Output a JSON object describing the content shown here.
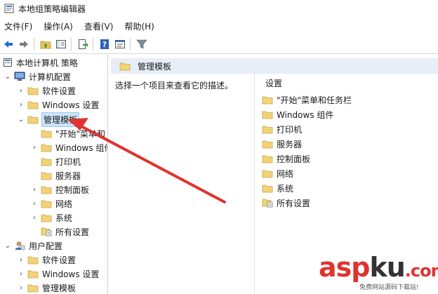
{
  "window": {
    "title": "本地组策略编辑器"
  },
  "menu": [
    {
      "label": "文件(F)"
    },
    {
      "label": "操作(A)"
    },
    {
      "label": "查看(V)"
    },
    {
      "label": "帮助(H)"
    }
  ],
  "toolbar": {
    "icons": [
      "back-arrow-icon",
      "forward-arrow-icon",
      "up-folder-icon",
      "show-hide-tree-icon",
      "export-list-icon",
      "help-icon",
      "properties-icon",
      "filter-icon"
    ]
  },
  "tree": [
    {
      "label": "本地计算机 策略",
      "depth": 0,
      "chev": "",
      "icon": "computer-policy-icon"
    },
    {
      "label": "计算机配置",
      "depth": 1,
      "chev": "v",
      "icon": "computer-icon"
    },
    {
      "label": "软件设置",
      "depth": 2,
      "chev": ">",
      "icon": "folder-icon"
    },
    {
      "label": "Windows 设置",
      "depth": 2,
      "chev": ">",
      "icon": "folder-icon"
    },
    {
      "label": "管理模板",
      "depth": 2,
      "chev": "v",
      "icon": "folder-icon",
      "selected": true
    },
    {
      "label": "\"开始\"菜单和",
      "depth": 3,
      "chev": "",
      "icon": "folder-icon"
    },
    {
      "label": "Windows 组件",
      "depth": 3,
      "chev": ">",
      "icon": "folder-icon"
    },
    {
      "label": "打印机",
      "depth": 3,
      "chev": "",
      "icon": "folder-icon"
    },
    {
      "label": "服务器",
      "depth": 3,
      "chev": "",
      "icon": "folder-icon"
    },
    {
      "label": "控制面板",
      "depth": 3,
      "chev": ">",
      "icon": "folder-icon"
    },
    {
      "label": "网络",
      "depth": 3,
      "chev": ">",
      "icon": "folder-icon"
    },
    {
      "label": "系统",
      "depth": 3,
      "chev": ">",
      "icon": "folder-icon"
    },
    {
      "label": "所有设置",
      "depth": 3,
      "chev": "",
      "icon": "settings-list-icon"
    },
    {
      "label": "用户配置",
      "depth": 1,
      "chev": "v",
      "icon": "user-icon"
    },
    {
      "label": "软件设置",
      "depth": 2,
      "chev": ">",
      "icon": "folder-icon"
    },
    {
      "label": "Windows 设置",
      "depth": 2,
      "chev": ">",
      "icon": "folder-icon"
    },
    {
      "label": "管理模板",
      "depth": 2,
      "chev": ">",
      "icon": "folder-icon"
    }
  ],
  "right": {
    "header": "管理模板",
    "description": "选择一个项目来查看它的描述。",
    "column": "设置",
    "items": [
      {
        "label": "\"开始\"菜单和任务栏",
        "icon": "folder-icon"
      },
      {
        "label": "Windows 组件",
        "icon": "folder-icon"
      },
      {
        "label": "打印机",
        "icon": "folder-icon"
      },
      {
        "label": "服务器",
        "icon": "folder-icon"
      },
      {
        "label": "控制面板",
        "icon": "folder-icon"
      },
      {
        "label": "网络",
        "icon": "folder-icon"
      },
      {
        "label": "系统",
        "icon": "folder-icon"
      },
      {
        "label": "所有设置",
        "icon": "settings-list-icon"
      }
    ]
  },
  "watermark": {
    "part1": "asp",
    "part2": "ku",
    "part3": ".com",
    "sub": "免费网站源码下载站!"
  },
  "colors": {
    "accent": "#cce4f7",
    "folder": "#e8c45a",
    "arrow": "#e0332f",
    "header": "#e7eef7"
  }
}
